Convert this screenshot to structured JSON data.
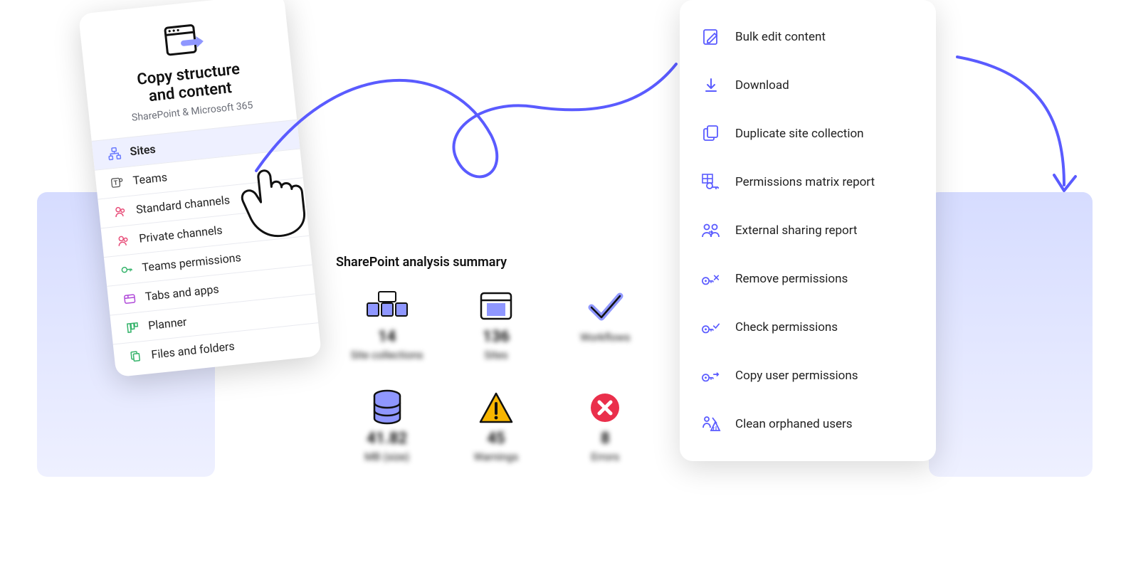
{
  "copy_card": {
    "title_l1": "Copy structure",
    "title_l2": "and content",
    "subtitle": "SharePoint & Microsoft 365",
    "items": [
      {
        "label": "Sites",
        "icon": "sites-icon",
        "color": "#6a7aff",
        "selected": true
      },
      {
        "label": "Teams",
        "icon": "teams-icon",
        "color": "#555",
        "selected": false
      },
      {
        "label": "Standard channels",
        "icon": "channel-icon",
        "color": "#e84f7a",
        "selected": false
      },
      {
        "label": "Private channels",
        "icon": "private-channel-icon",
        "color": "#e84f7a",
        "selected": false
      },
      {
        "label": "Teams permissions",
        "icon": "key-icon",
        "color": "#34b36a",
        "selected": false
      },
      {
        "label": "Tabs and apps",
        "icon": "tabs-icon",
        "color": "#b04ad9",
        "selected": false
      },
      {
        "label": "Planner",
        "icon": "planner-icon",
        "color": "#34b36a",
        "selected": false
      },
      {
        "label": "Files and folders",
        "icon": "files-icon",
        "color": "#34b36a",
        "selected": false
      }
    ]
  },
  "analysis": {
    "title": "SharePoint analysis summary",
    "stats": [
      {
        "value": "14",
        "label": "Site collections",
        "icon": "site-collections-icon"
      },
      {
        "value": "136",
        "label": "Sites",
        "icon": "site-icon"
      },
      {
        "value": "",
        "label": "Workflows",
        "icon": "check-icon"
      },
      {
        "value": "41.82",
        "label": "MB (size)",
        "icon": "size-icon"
      },
      {
        "value": "45",
        "label": "Warnings",
        "icon": "warning-icon"
      },
      {
        "value": "8",
        "label": "Errors",
        "icon": "error-icon"
      }
    ]
  },
  "actions": {
    "items": [
      {
        "label": "Bulk edit content",
        "icon": "edit-icon"
      },
      {
        "label": "Download",
        "icon": "download-icon"
      },
      {
        "label": "Duplicate site collection",
        "icon": "duplicate-icon"
      },
      {
        "label": "Permissions matrix report",
        "icon": "matrix-key-icon"
      },
      {
        "label": "External sharing report",
        "icon": "people-share-icon"
      },
      {
        "label": "Remove permissions",
        "icon": "key-remove-icon"
      },
      {
        "label": "Check permissions",
        "icon": "key-check-icon"
      },
      {
        "label": "Copy user permissions",
        "icon": "key-copy-icon"
      },
      {
        "label": "Clean orphaned users",
        "icon": "broom-user-icon"
      }
    ]
  },
  "colors": {
    "accent": "#5a5bff",
    "warn": "#f7b500",
    "error": "#ea2f4b"
  }
}
